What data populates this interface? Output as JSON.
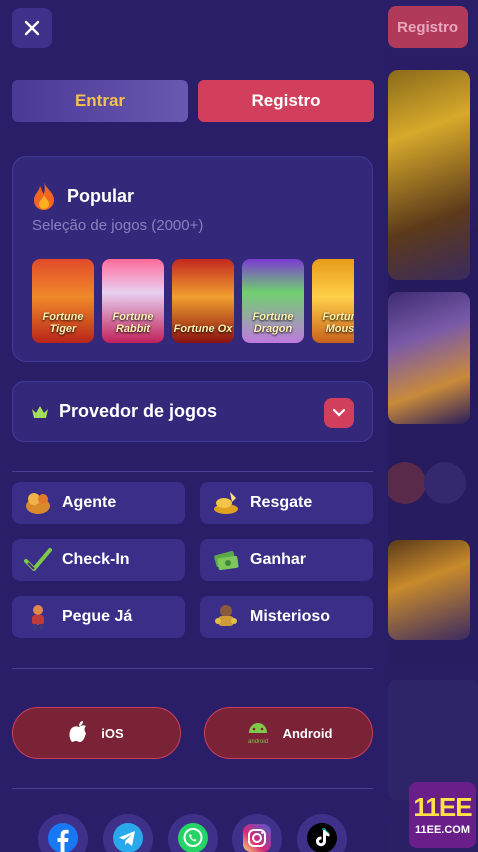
{
  "background": {
    "register_label": "Registro"
  },
  "brand": {
    "logo_big": "11EE",
    "logo_small": "11EE.COM"
  },
  "drawer": {
    "close_icon": "close-icon",
    "login_label": "Entrar",
    "register_label": "Registro",
    "popular": {
      "title": "Popular",
      "subtitle": "Seleção de jogos (2000+)",
      "games": [
        {
          "title": "Fortune Tiger"
        },
        {
          "title": "Fortune Rabbit"
        },
        {
          "title": "Fortune Ox"
        },
        {
          "title": "Fortune Dragon"
        },
        {
          "title": "Fortune Mouse"
        }
      ]
    },
    "provider_label": "Provedor de jogos",
    "menu": [
      {
        "label": "Agente"
      },
      {
        "label": "Resgate"
      },
      {
        "label": "Check-In"
      },
      {
        "label": "Ganhar"
      },
      {
        "label": "Pegue Já"
      },
      {
        "label": "Misterioso"
      }
    ],
    "apps": {
      "ios_label": "iOS",
      "android_label": "Android",
      "android_icon_text": "android"
    },
    "social": [
      "facebook",
      "telegram",
      "whatsapp",
      "instagram",
      "tiktok"
    ]
  },
  "colors": {
    "accent": "#d23f5c",
    "gold": "#f2c14e",
    "drawer_bg": "#2a1e68",
    "card_bg": "#33287a"
  }
}
